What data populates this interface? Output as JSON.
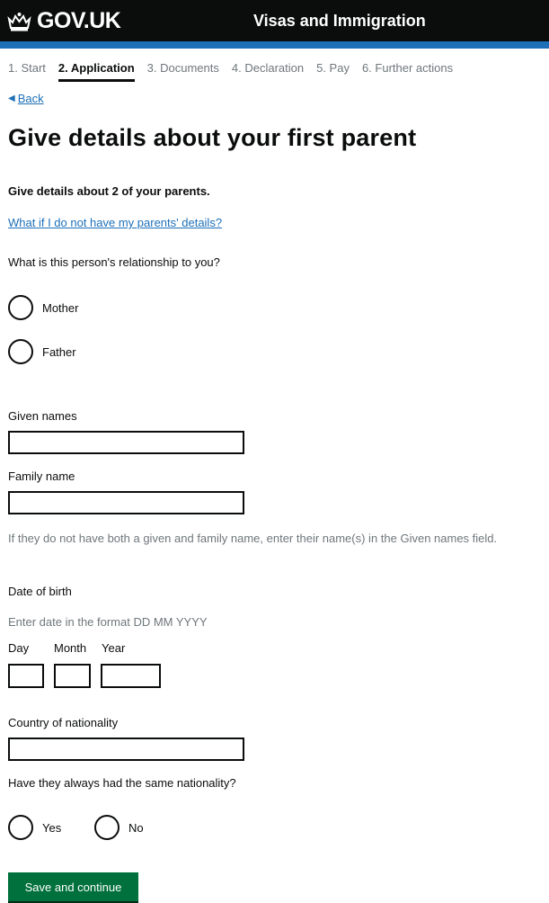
{
  "header": {
    "logo_text": "GOV.UK",
    "logo_icon": "crown-icon",
    "service_name": "Visas and Immigration",
    "colors": {
      "header_bg": "#0b0c0c",
      "accent_bar": "#1d70b8"
    }
  },
  "steps": [
    {
      "label": "1. Start"
    },
    {
      "label": "2. Application"
    },
    {
      "label": "3. Documents"
    },
    {
      "label": "4. Declaration"
    },
    {
      "label": "5. Pay"
    },
    {
      "label": "6. Further actions"
    }
  ],
  "back_link": "Back",
  "page_title": "Give details about your first parent",
  "intro": "Give details about 2 of your parents.",
  "no_details_link": "What if I do not have my parents' details?",
  "relationship": {
    "question": "What is this person's relationship to you?",
    "options": [
      "Mother",
      "Father"
    ]
  },
  "given_names": {
    "label": "Given names",
    "value": ""
  },
  "family_name": {
    "label": "Family name",
    "value": ""
  },
  "name_hint": "If they do not have both a given and family name, enter their name(s) in the Given names field.",
  "date_of_birth": {
    "label": "Date of birth",
    "hint": "Enter date in the format DD MM YYYY",
    "day_label": "Day",
    "month_label": "Month",
    "year_label": "Year"
  },
  "nationality": {
    "label": "Country of nationality",
    "value": ""
  },
  "same_nationality": {
    "question": "Have they always had the same nationality?",
    "options": [
      "Yes",
      "No"
    ]
  },
  "submit_label": "Save and continue",
  "colors": {
    "button": "#00703c",
    "link": "#1d70b8"
  }
}
